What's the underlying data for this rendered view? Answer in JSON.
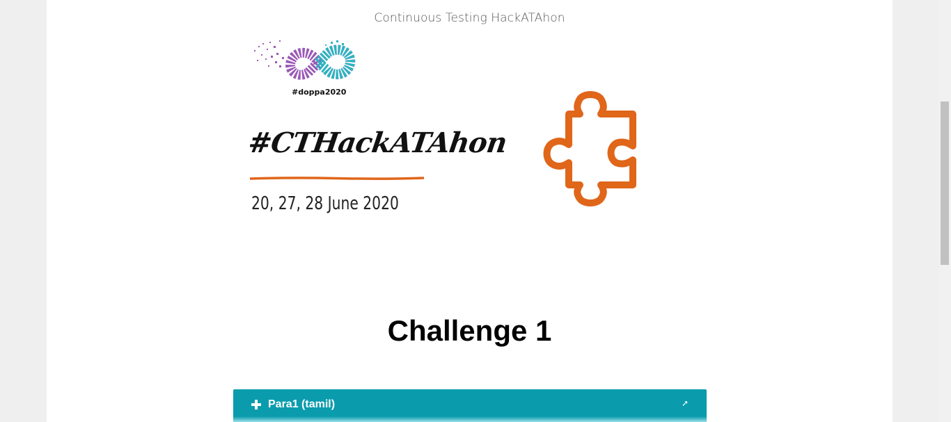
{
  "header": {
    "site_title": "Continuous Testing HackATAhon"
  },
  "banner": {
    "logo_icon": "infinity-logo-icon",
    "logo_tag": "#doppa2020",
    "event_title": "#CTHackATAhon",
    "event_dates": "20, 27, 28 June 2020",
    "puzzle_icon": "puzzle-piece-icon",
    "accent_color": "#e0661a",
    "logo_colors": [
      "#9b59b6",
      "#2bb5c0"
    ]
  },
  "main": {
    "heading": "Challenge 1",
    "accordion": [
      {
        "label": "Para1 (tamil)",
        "icon": "plus-icon",
        "arrow_icon": "arrow-icon",
        "expanded": false
      }
    ]
  },
  "colors": {
    "accordion_bg": "#0a9cad",
    "page_bg": "#ffffff",
    "outer_bg": "#efefef"
  }
}
